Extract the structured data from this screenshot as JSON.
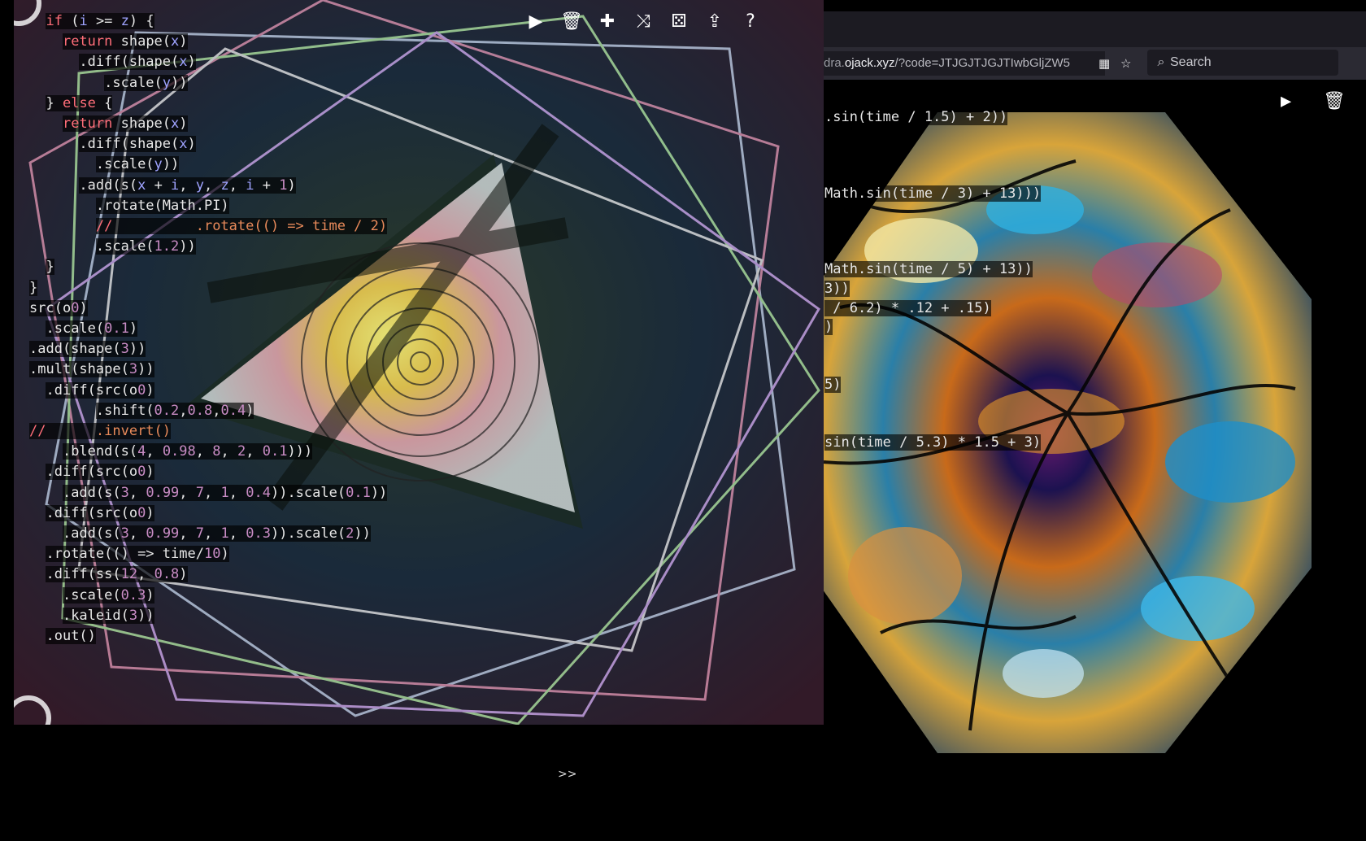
{
  "browser": {
    "url_prefix": "dra.",
    "url_host": "ojack.xyz",
    "url_path": "/?code=JTJGJTJGJTIwbGljZW5",
    "search_placeholder": "Search",
    "icons": [
      "grid-icon",
      "star-icon",
      "search-icon"
    ]
  },
  "back_toolbar": {
    "icons": [
      "play-icon",
      "trash-icon"
    ]
  },
  "back_code": [
    ".sin(time / 1.5) + 2))",
    "Math.sin(time / 3) + 13)))",
    "Math.sin(time / 5) + 13))",
    "3))",
    " / 6.2) * .12 + .15)",
    ")",
    "5)",
    "sin(time / 5.3) * 1.5 + 3)"
  ],
  "hydra_toolbar": {
    "icons": [
      "play-icon",
      "trash-icon",
      "puzzle-icon",
      "shuffle-icon",
      "dice-icon",
      "upload-icon",
      "help-icon"
    ]
  },
  "code_lines": [
    "  if (i >= z) {",
    "    return shape(x)",
    "      .diff(shape(x)",
    "         .scale(y))",
    "  } else {",
    "    return shape(x)",
    "      .diff(shape(x)",
    "        .scale(y))",
    "      .add(s(x + i, y, z, i + 1)",
    "        .rotate(Math.PI)",
    "        //          .rotate(() => time / 2)",
    "        .scale(1.2))",
    "  }",
    "}",
    "",
    "src(o0)",
    "  .scale(0.1)",
    ".add(shape(3))",
    ".mult(shape(3))",
    "  .diff(src(o0)",
    "        .shift(0.2,0.8,0.4)",
    "//      .invert()",
    "    .blend(s(4, 0.98, 8, 2, 0.1)))",
    "  .diff(src(o0)",
    "    .add(s(3, 0.99, 7, 1, 0.4)).scale(0.1))",
    "  .diff(src(o0)",
    "    .add(s(3, 0.99, 7, 1, 0.3)).scale(2))",
    "  .rotate(() => time/10)",
    "  .diff(ss(12, 0.8)",
    "    .scale(0.3)",
    "    .kaleid(3))",
    "  .out()"
  ],
  "console_prompt": ">>",
  "colors": {
    "keyword": "#ff6e79",
    "number": "#c98cc5",
    "variable": "#9fa3ff",
    "comment": "#e88a5a",
    "browser_toolbar": "#2b2a33"
  }
}
